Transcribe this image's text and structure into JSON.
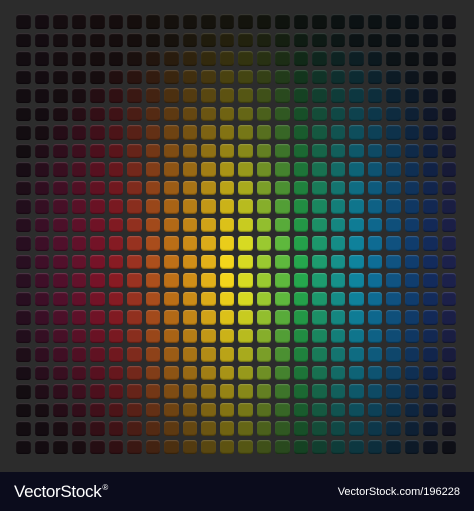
{
  "image": {
    "subject": "rainbow tile mosaic",
    "grid_columns": 24,
    "grid_rows": 24,
    "background_color": "#2c2c2c",
    "colors": {
      "magenta": "#e0187c",
      "red": "#ee1c3a",
      "orange": "#f39019",
      "yellow": "#f5e21b",
      "green": "#26a84a",
      "cyan": "#0ea7d8",
      "blue": "#1652b8",
      "violet": "#6b1f8f"
    }
  },
  "footer": {
    "brand": "VectorStock",
    "registered_mark": "®",
    "credit": "VectorStock.com/196228",
    "background_color": "#0b0c1c"
  }
}
